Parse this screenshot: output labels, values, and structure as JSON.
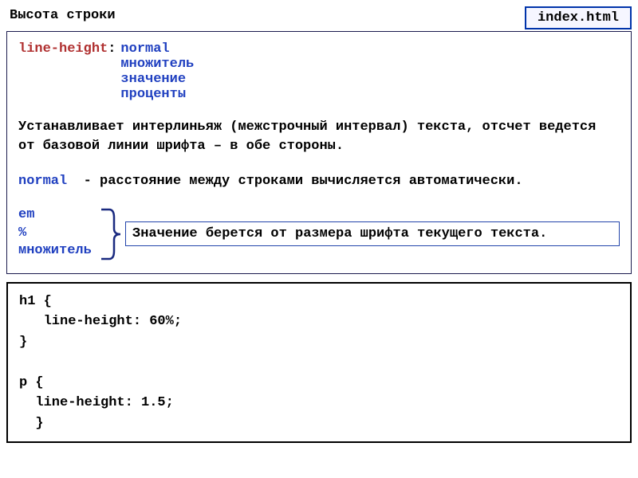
{
  "header": {
    "title": "Высота строки",
    "filename": "index.html"
  },
  "syntax": {
    "property": "line-height",
    "values": [
      "normal",
      "множитель",
      "значение",
      "проценты"
    ]
  },
  "description": "Устанавливает интерлиньяж (межстрочный интервал) текста, отсчет ведется от базовой линии шрифта – в обе стороны.",
  "normal_line": {
    "keyword": "normal",
    "text": "- расстояние между строками вычисляется автоматически."
  },
  "bracket": {
    "keys": [
      "em",
      "%",
      "множитель"
    ],
    "text": "Значение берется от размера шрифта текущего текста."
  },
  "code": "h1 {\n   line-height: 60%;\n}\n\np {\n  line-height: 1.5;\n  }"
}
